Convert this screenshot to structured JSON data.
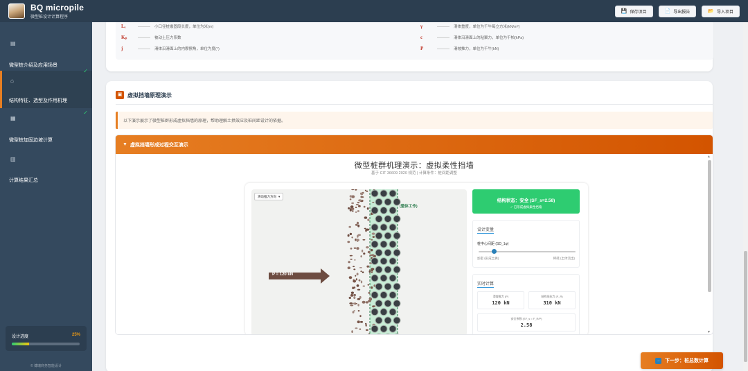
{
  "app": {
    "title": "BQ micropile",
    "subtitle": "微型桩设计计算程序"
  },
  "header": {
    "save_label": "保存项目",
    "export_label": "导出报告",
    "import_label": "导入项目"
  },
  "sidebar": {
    "items": [
      {
        "label": "微型桩介绍及应用场景",
        "icon": "book-icon",
        "done": false
      },
      {
        "label": "结构特征、选型及作用机理",
        "icon": "building-icon",
        "done": true,
        "active": true
      },
      {
        "label": "微型桩加固边坡计算",
        "icon": "calculator-icon",
        "done": true
      },
      {
        "label": "计算结果汇总",
        "icon": "chart-icon",
        "done": false
      }
    ],
    "progress_label": "设计进度",
    "progress_value": "25%",
    "progress_fraction": 0.25,
    "copyright": "© 博瑞商务智能设计"
  },
  "symbols": {
    "left": [
      {
        "sym": "Lₑ",
        "desc": "小口径桩嵌固段长度，单位为米(m)"
      },
      {
        "sym": "Kₚ",
        "desc": "被动土压力系数"
      },
      {
        "sym": "j",
        "desc": "滑体沿滑面上的内摩擦角，单位为度(°)"
      }
    ],
    "right": [
      {
        "sym": "γ",
        "desc": "滑体重度，单位为千牛每立方米(kN/m³)"
      },
      {
        "sym": "c",
        "desc": "滑体沿滑面上的粘聚力，单位为千帕(kPa)"
      },
      {
        "sym": "P",
        "desc": "滑坡推力，单位为千牛(kN)"
      }
    ]
  },
  "section": {
    "title": "虚拟挡墙原理演示",
    "notice": "以下演示展示了微型桩群形成虚拟挡墙的原理，帮助理解土拱效应及桩间距设计的依据。"
  },
  "demo": {
    "bar_title": "虚拟挡墙形成过程交互演示",
    "title": "微型桩群机理演示：虚拟柔性挡墙",
    "subtitle": "基于 CIT 36609 2020 规范 | 计算条件：桩间距调整",
    "direction_select": "滑动推力方向",
    "force_label": "P = 120 kN",
    "wall_label": "(整体工作)",
    "status_title": "结构状态：安全 (SF_s=2.58)",
    "status_sub": "✓ 已形成虚拟柔性挡墙",
    "vars_title": "设计变量",
    "var_label": "桩中心间距 (SD_1φ)",
    "slider_min": "加密 (形成土拱)",
    "slider_max": "稀疏 (土体流出)",
    "slider_fraction": 0.16,
    "calc_title": "实时计算",
    "metrics": [
      {
        "label": "滑坡推力 (P)",
        "value": "120 kN"
      },
      {
        "label": "结构抵抗力 (F_R)",
        "value": "310 kN"
      },
      {
        "label": "安全系数 (SF_s = F_R/P)",
        "value": "2.58"
      }
    ]
  },
  "next_button": "下一步：桩总数计算",
  "colors": {
    "accent": "#e67e22",
    "header": "#2c3e50",
    "sidebar": "#34495e",
    "safe": "#2ecc71"
  }
}
